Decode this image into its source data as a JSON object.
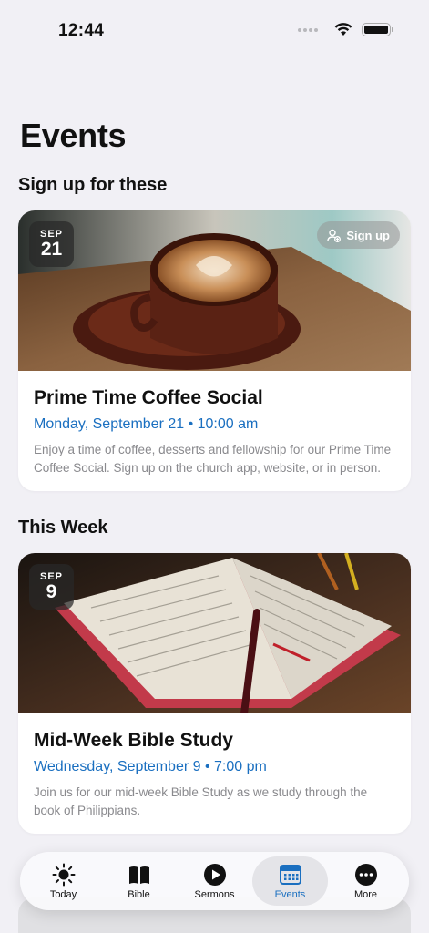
{
  "status_bar": {
    "time": "12:44"
  },
  "page": {
    "title": "Events"
  },
  "sections": [
    {
      "title": "Sign up for these",
      "card": {
        "month": "SEP",
        "day": "21",
        "signup_label": "Sign up",
        "title": "Prime Time Coffee Social",
        "datetime": "Monday, September 21 • 10:00 am",
        "description": "Enjoy a time of coffee, desserts and fellowship for our Prime Time Coffee Social. Sign up on the church app, website, or in person."
      }
    },
    {
      "title": "This Week",
      "card": {
        "month": "SEP",
        "day": "9",
        "title": "Mid-Week Bible Study",
        "datetime": "Wednesday, September 9 • 7:00 pm",
        "description": "Join us for our mid-week Bible Study as we study through the book of Philippians."
      }
    }
  ],
  "tab_bar": {
    "tabs": [
      {
        "label": "Today",
        "icon": "sun-icon"
      },
      {
        "label": "Bible",
        "icon": "book-icon"
      },
      {
        "label": "Sermons",
        "icon": "play-icon"
      },
      {
        "label": "Events",
        "icon": "calendar-icon"
      },
      {
        "label": "More",
        "icon": "ellipsis-icon"
      }
    ],
    "active": "Events",
    "active_color": "#1a6fc0"
  }
}
